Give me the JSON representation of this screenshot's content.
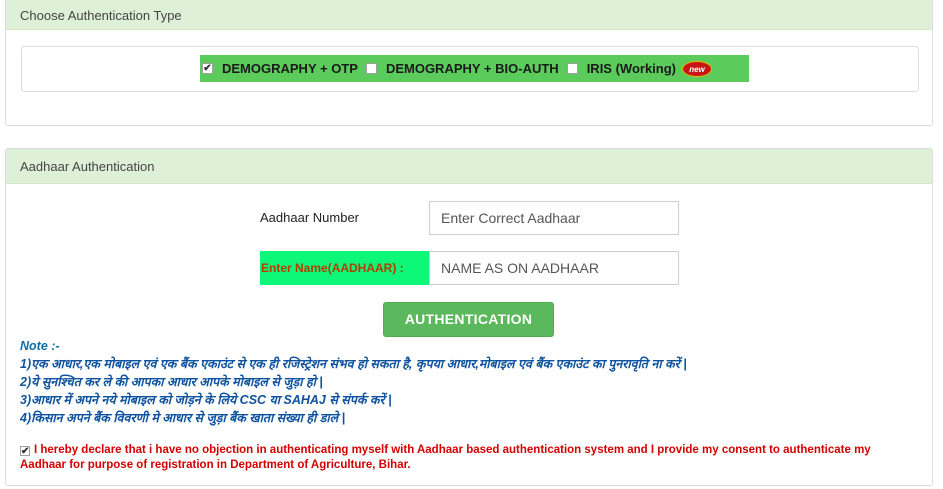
{
  "auth_type": {
    "header": "Choose Authentication Type",
    "options": [
      {
        "label": "DEMOGRAPHY + OTP",
        "checked": true
      },
      {
        "label": "DEMOGRAPHY + BIO-AUTH",
        "checked": false
      },
      {
        "label": "IRIS (Working)",
        "checked": false
      }
    ],
    "new_badge": "new"
  },
  "aadhaar": {
    "header": "Aadhaar Authentication",
    "number_label": "Aadhaar Number",
    "number_placeholder": "Enter Correct Aadhaar",
    "name_label": "Enter Name(AADHAAR) :",
    "name_placeholder": "NAME AS ON AADHAAR",
    "button": "AUTHENTICATION"
  },
  "notes": {
    "title": "Note :-",
    "items": [
      "1)एक आधार,एक मोबाइल एवं एक बैंक एकाउंट से एक ही रजिस्ट्रेशन संभव हो सकता है, कृपया आधार,मोबाइल एवं बैंक एकाउंट का पुनरावृति ना करें |",
      "2)ये सुनश्चित कर ले की आपका आधार आपके मोबाइल से जुड़ा हो |",
      "3)आधार में अपने नये मोबाइल को जोड़ने के लिये CSC या SAHAJ से संपर्क करें |",
      "4)किसान अपने बैंक विवरणी मे आधार से जुड़ा बैंक खाता संख्या ही डाले |"
    ]
  },
  "declaration": {
    "checked": true,
    "text": "I hereby declare that i have no objection in authenticating myself with Aadhaar based authentication system and I provide my consent to authenticate my Aadhaar for purpose of registration in Department of Agriculture, Bihar."
  },
  "colors": {
    "panel_header": "#def0d8",
    "option_strip": "#5bcc5b",
    "name_label_bg": "#0df779",
    "button": "#5cb85c",
    "note_text": "#0f53a0",
    "declare_text": "#d50000"
  }
}
